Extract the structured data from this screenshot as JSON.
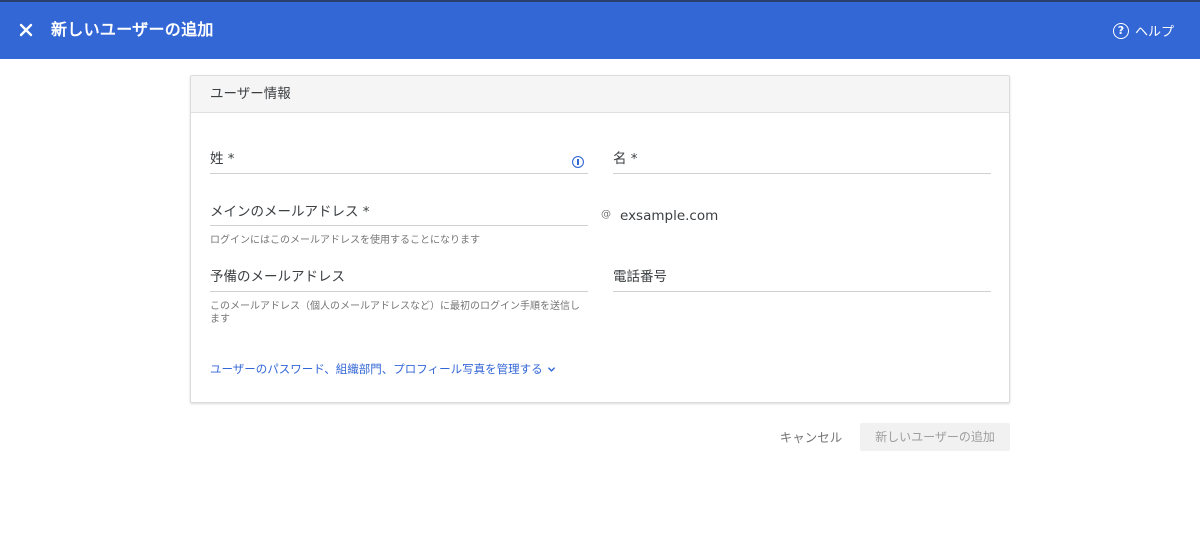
{
  "header": {
    "title": "新しいユーザーの追加",
    "help_label": "ヘルプ",
    "help_glyph": "?"
  },
  "card": {
    "section_title": "ユーザー情報",
    "last_name": {
      "label": "姓 *",
      "value": ""
    },
    "first_name": {
      "label": "名 *",
      "value": ""
    },
    "primary_email": {
      "label": "メインのメールアドレス *",
      "hint": "ログインにはこのメールアドレスを使用することになります",
      "at": "@",
      "domain": "exsample.com"
    },
    "secondary_email": {
      "label": "予備のメールアドレス",
      "hint": "このメールアドレス（個人のメールアドレスなど）に最初のログイン手順を送信します"
    },
    "phone": {
      "label": "電話番号"
    },
    "manage_link": "ユーザーのパスワード、組織部門、プロフィール写真を管理する"
  },
  "actions": {
    "cancel_label": "キャンセル",
    "add_label": "新しいユーザーの追加"
  },
  "colors": {
    "header_bg": "#3367d6",
    "link": "#3367d6",
    "disabled_button_bg": "#f1f1f1"
  },
  "icons": {
    "close": "close-icon",
    "help": "help-circle-icon",
    "info": "info-icon",
    "chevron": "chevron-down-icon"
  }
}
